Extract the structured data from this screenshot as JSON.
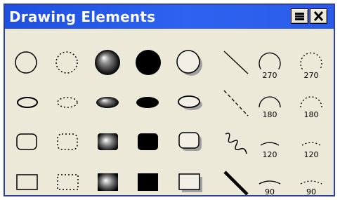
{
  "window": {
    "title": "Drawing Elements",
    "accent_color": "#2d63f0",
    "background_color": "#ece9d8",
    "buttons": [
      {
        "name": "window-menu-button",
        "icon": "menu-icon"
      },
      {
        "name": "close-button",
        "icon": "close-icon"
      }
    ]
  },
  "palette": {
    "columns": [
      "plain",
      "dotted",
      "shaded",
      "filled",
      "shadowed",
      "line",
      "arc",
      "dotted-arc"
    ],
    "rows": [
      {
        "shape": "circle",
        "line_style": "diagonal",
        "arc_degrees": "270"
      },
      {
        "shape": "ellipse",
        "line_style": "dashed-diagonal",
        "arc_degrees": "180"
      },
      {
        "shape": "rounded-rectangle",
        "line_style": "squiggle",
        "arc_degrees": "120"
      },
      {
        "shape": "rectangle",
        "line_style": "thick-diagonal",
        "arc_degrees": "90"
      }
    ]
  }
}
